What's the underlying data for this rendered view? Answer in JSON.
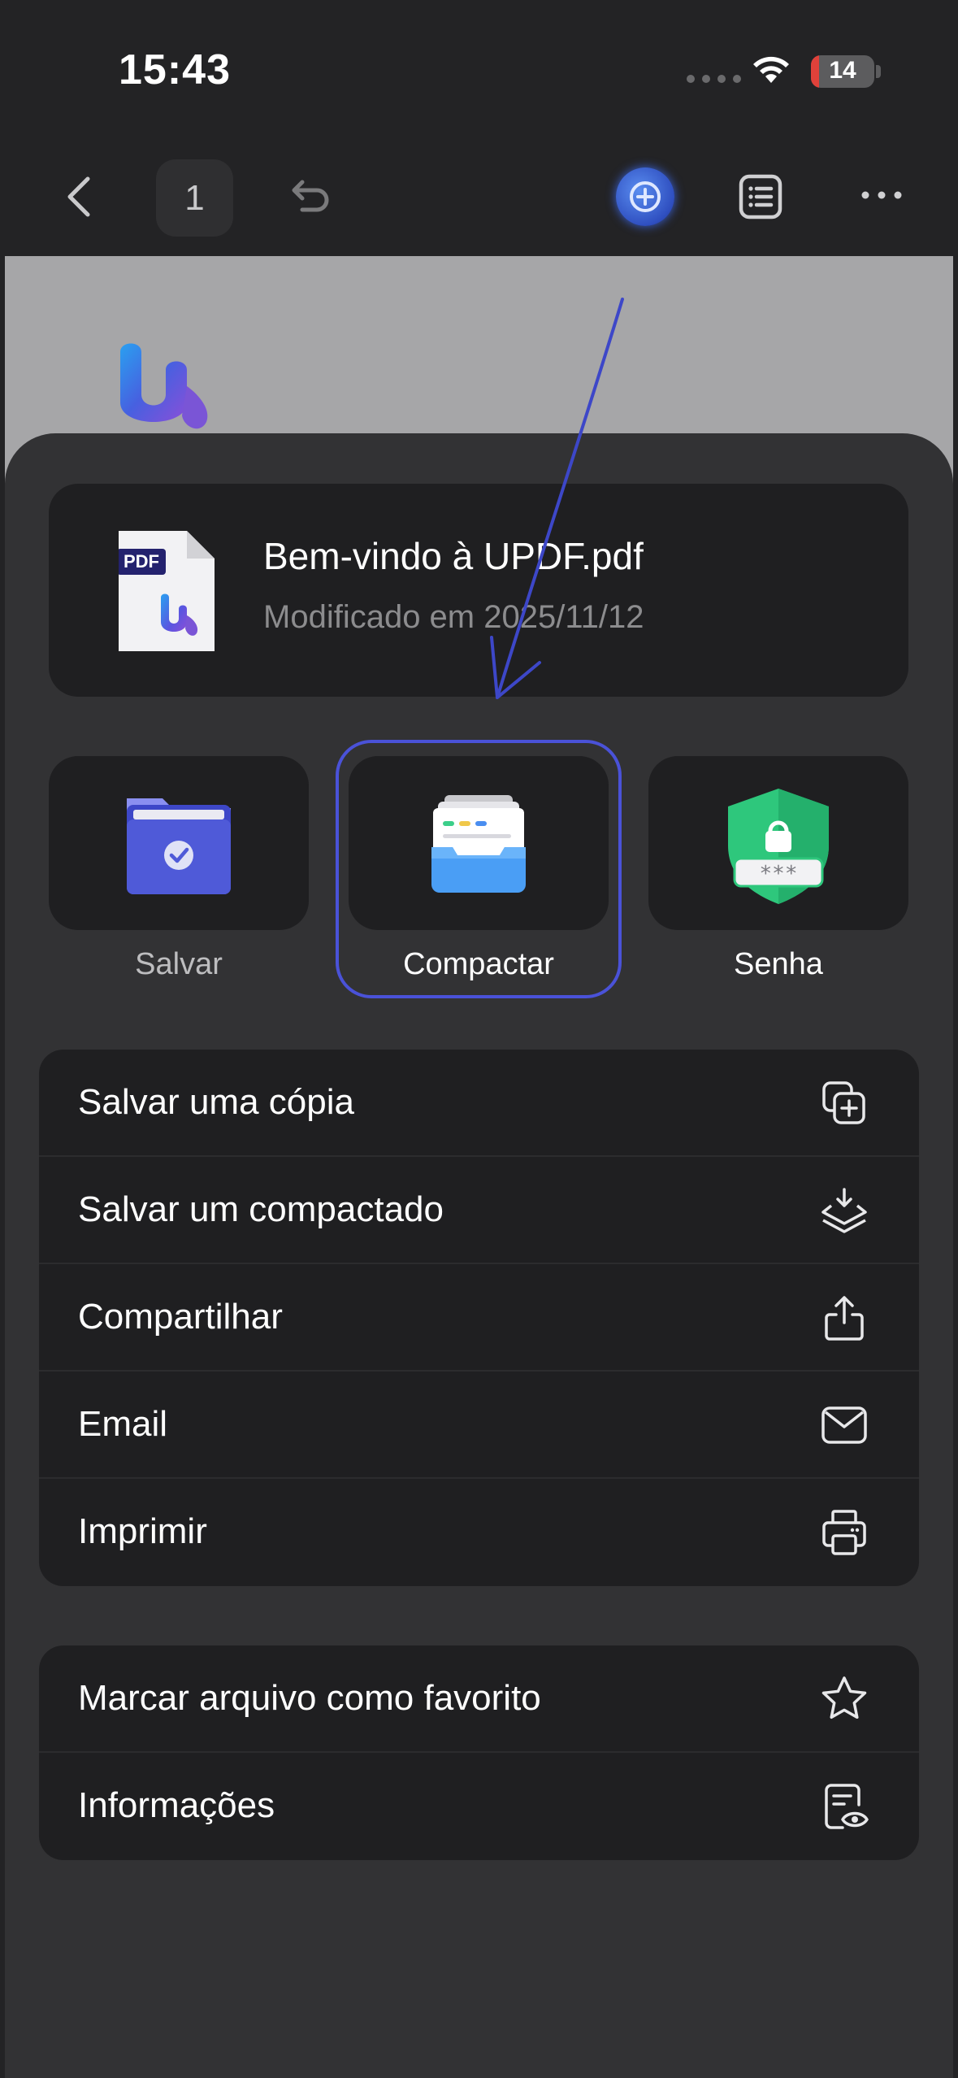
{
  "status_bar": {
    "time": "15:43",
    "battery_level": "14"
  },
  "toolbar": {
    "page_number": "1"
  },
  "file": {
    "badge": "PDF",
    "name": "Bem-vindo à UPDF.pdf",
    "modified": "Modificado em 2025/11/12"
  },
  "actions": [
    {
      "label": "Salvar",
      "icon": "folder-check-icon"
    },
    {
      "label": "Compactar",
      "icon": "file-cabinet-icon"
    },
    {
      "label": "Senha",
      "icon": "shield-lock-icon",
      "mask": "***"
    }
  ],
  "menu_primary": [
    {
      "label": "Salvar uma cópia",
      "icon": "copy-plus-icon"
    },
    {
      "label": "Salvar um compactado",
      "icon": "layers-download-icon"
    },
    {
      "label": "Compartilhar",
      "icon": "share-icon"
    },
    {
      "label": "Email",
      "icon": "mail-icon"
    },
    {
      "label": "Imprimir",
      "icon": "printer-icon"
    }
  ],
  "menu_secondary": [
    {
      "label": "Marcar arquivo como favorito",
      "icon": "star-icon"
    },
    {
      "label": "Informações",
      "icon": "document-eye-icon"
    }
  ],
  "colors": {
    "background": "#232325",
    "sheet": "#323234",
    "card": "#1f1f21",
    "highlight": "#4a52d8",
    "annotation": "#3d47c8"
  }
}
